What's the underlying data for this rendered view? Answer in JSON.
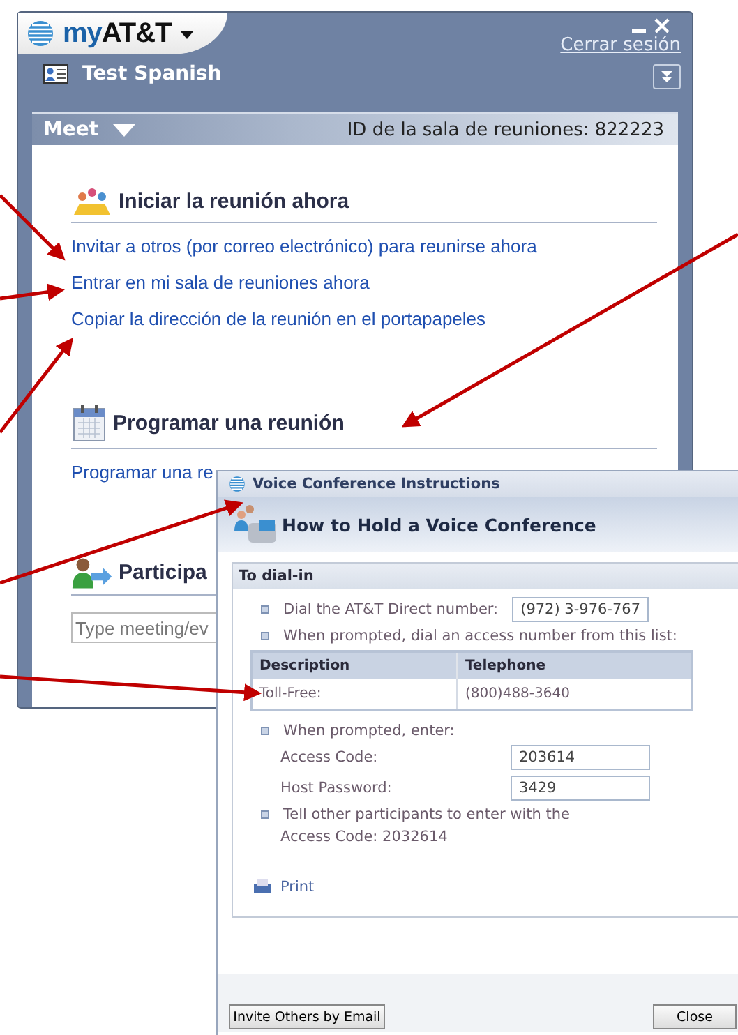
{
  "main_window": {
    "brand_prefix": "my",
    "brand": "AT&T",
    "logout": "Cerrar sesión",
    "user": "Test Spanish",
    "meet_bar": {
      "menu": "Meet",
      "room_id": "ID de la sala de reuniones: 822223"
    },
    "sections": [
      {
        "kind": "people",
        "title": "Iniciar la reunión ahora",
        "links": [
          "Invitar a otros (por correo electrónico) para reunirse ahora",
          "Entrar en mi sala de reuniones ahora",
          "Copiar la dirección de la reunión en el portapapeles"
        ]
      },
      {
        "kind": "calendar",
        "title": "Programar una reunión",
        "links": [
          "Programar una re"
        ]
      },
      {
        "kind": "participant",
        "title": "Participa",
        "placeholder": "Type meeting/ev"
      }
    ]
  },
  "dialog": {
    "title": "Voice Conference Instructions",
    "heading": "How to Hold a Voice Conference",
    "section": "To dial-in",
    "direct_label": "Dial the AT&T Direct number:",
    "direct_number": "(972) 3-976-767",
    "prompt_list": "When prompted, dial an access number from this list:",
    "table": {
      "columns": [
        "Description",
        "Telephone"
      ],
      "rows": [
        [
          "Toll-Free:",
          "(800)488-3640"
        ]
      ]
    },
    "prompt_enter": "When prompted, enter:",
    "fields": [
      {
        "label": "Access Code:",
        "value": "203614"
      },
      {
        "label": "Host Password:",
        "value": "3429"
      }
    ],
    "tell": "Tell other participants to enter with the",
    "tell_code": "Access Code: 2032614",
    "print": "Print",
    "buttons": [
      "Invite Others by Email",
      "Close"
    ]
  }
}
